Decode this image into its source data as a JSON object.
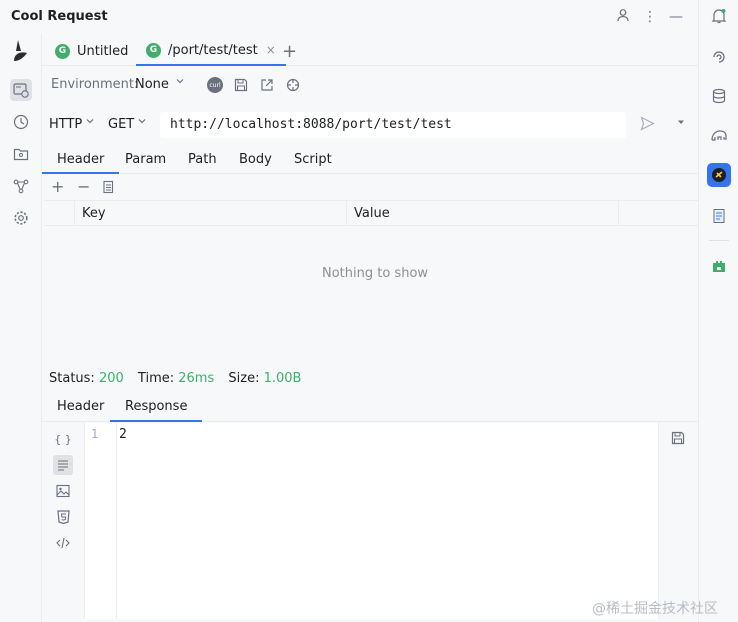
{
  "window": {
    "title": "Cool Request"
  },
  "tabs": [
    {
      "badge": "G",
      "label": "Untitled",
      "active": false
    },
    {
      "badge": "G",
      "label": "/port/test/test",
      "active": true,
      "close": "×"
    }
  ],
  "tab_add": "+",
  "environment": {
    "label": "Environment:",
    "value": "None",
    "chevron": "⌄",
    "curl_label": "curl"
  },
  "request": {
    "protocol": "HTTP",
    "method": "GET",
    "url": "http://localhost:8088/port/test/test"
  },
  "request_tabs": [
    "Header",
    "Param",
    "Path",
    "Body",
    "Script"
  ],
  "request_active_tab": "Header",
  "table": {
    "columns": [
      "Key",
      "Value"
    ],
    "empty_text": "Nothing to show"
  },
  "status": {
    "status_label": "Status:",
    "status_value": "200",
    "time_label": "Time:",
    "time_value": "26ms",
    "size_label": "Size:",
    "size_value": "1.00B"
  },
  "response_tabs": [
    "Header",
    "Response"
  ],
  "response_active_tab": "Response",
  "response_body": {
    "line_number": "1",
    "content": "2"
  },
  "left_sidebar_icons": [
    "logo-icon",
    "api-request-icon",
    "history-icon",
    "folder-icon",
    "trace-icon",
    "gear-icon"
  ],
  "right_sidebar_icons": [
    "bell-icon",
    "swirl-icon",
    "database-icon",
    "elephant-icon",
    "cool-request-icon",
    "document-icon",
    "plugin-icon"
  ],
  "watermark": "@稀土掘金技术社区",
  "colors": {
    "accent": "#3574f0",
    "success": "#3fae6a",
    "background": "#f7f8fa",
    "editor_background": "#ffffff"
  }
}
